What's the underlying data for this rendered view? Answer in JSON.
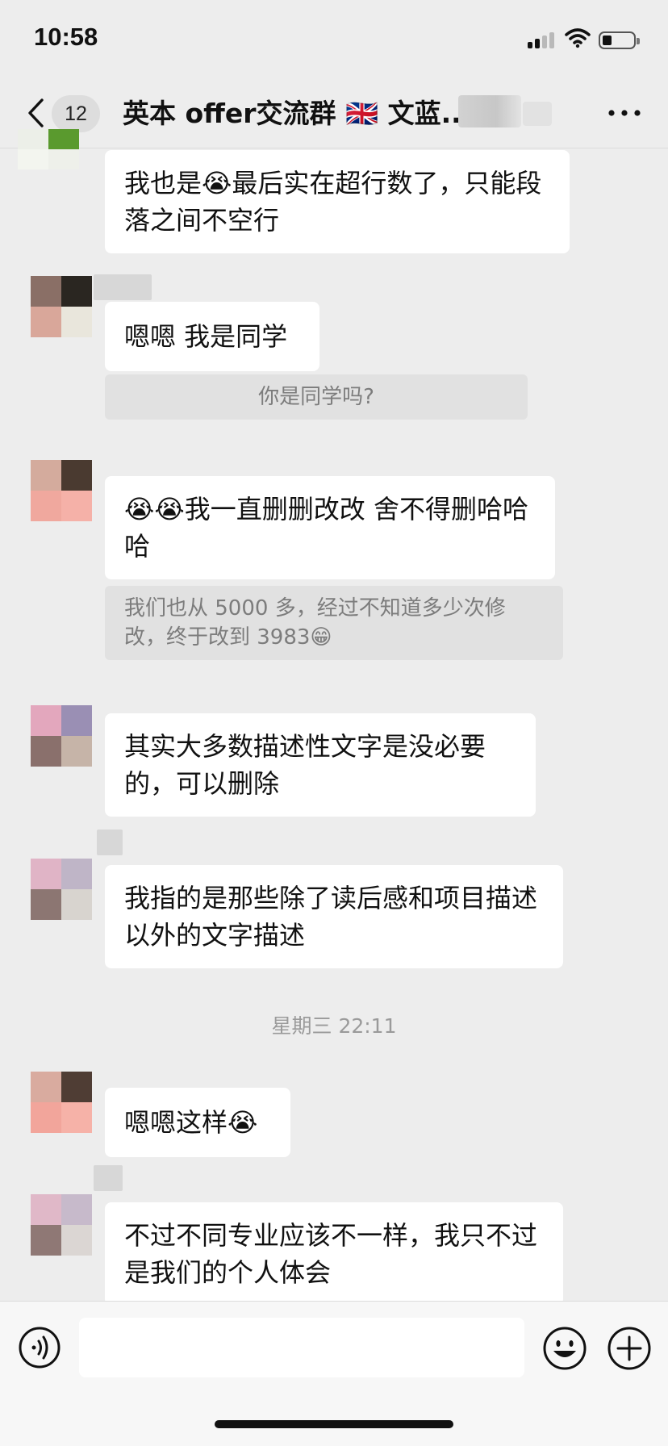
{
  "status_bar": {
    "time": "10:58"
  },
  "nav": {
    "back_label": "<",
    "unread_count": "12",
    "title": "英本 offer交流群 🇬🇧 文蓝...",
    "more_label": "..."
  },
  "messages": [
    {
      "text": "我也是😭最后实在超行数了，只能段落之间不空行"
    },
    {
      "text": "嗯嗯 我是同学",
      "quote": "你是同学吗?"
    },
    {
      "text": "😭😭我一直删删改改 舍不得删哈哈哈",
      "quote": "我们也从 5000 多，经过不知道多少次修改，终于改到 3983😁"
    },
    {
      "text": "其实大多数描述性文字是没必要的，可以删除"
    },
    {
      "text": "我指的是那些除了读后感和项目描述以外的文字描述"
    },
    {
      "text": "嗯嗯这样😭"
    },
    {
      "text": "不过不同专业应该不一样，我只不过是我们的个人体会"
    }
  ],
  "time_divider": "星期三 22:11",
  "icons": {
    "back": "chevron-left-icon",
    "more": "more-dots-icon",
    "voice": "voice-icon",
    "emoji": "emoji-face-icon",
    "plus": "plus-circle-icon"
  },
  "colors": {
    "background": "#ededed",
    "bubble": "#ffffff",
    "quote": "#e1e1e1",
    "input_bar": "#f7f7f7"
  }
}
